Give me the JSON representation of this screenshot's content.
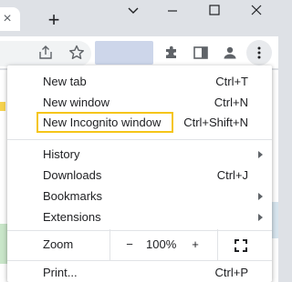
{
  "tabstrip": {
    "close_icon": "×",
    "new_tab_icon": "+"
  },
  "menu": {
    "items": [
      {
        "label": "New tab",
        "shortcut": "Ctrl+T"
      },
      {
        "label": "New window",
        "shortcut": "Ctrl+N"
      },
      {
        "label": "New Incognito window",
        "shortcut": "Ctrl+Shift+N"
      },
      {
        "label": "History",
        "shortcut": ""
      },
      {
        "label": "Downloads",
        "shortcut": "Ctrl+J"
      },
      {
        "label": "Bookmarks",
        "shortcut": ""
      },
      {
        "label": "Extensions",
        "shortcut": ""
      },
      {
        "label": "Print...",
        "shortcut": "Ctrl+P"
      }
    ],
    "zoom": {
      "label": "Zoom",
      "minus": "−",
      "value": "100%",
      "plus": "+"
    }
  },
  "colors": {
    "highlight_border": "#f5c518",
    "frame": "#dee1e6"
  }
}
